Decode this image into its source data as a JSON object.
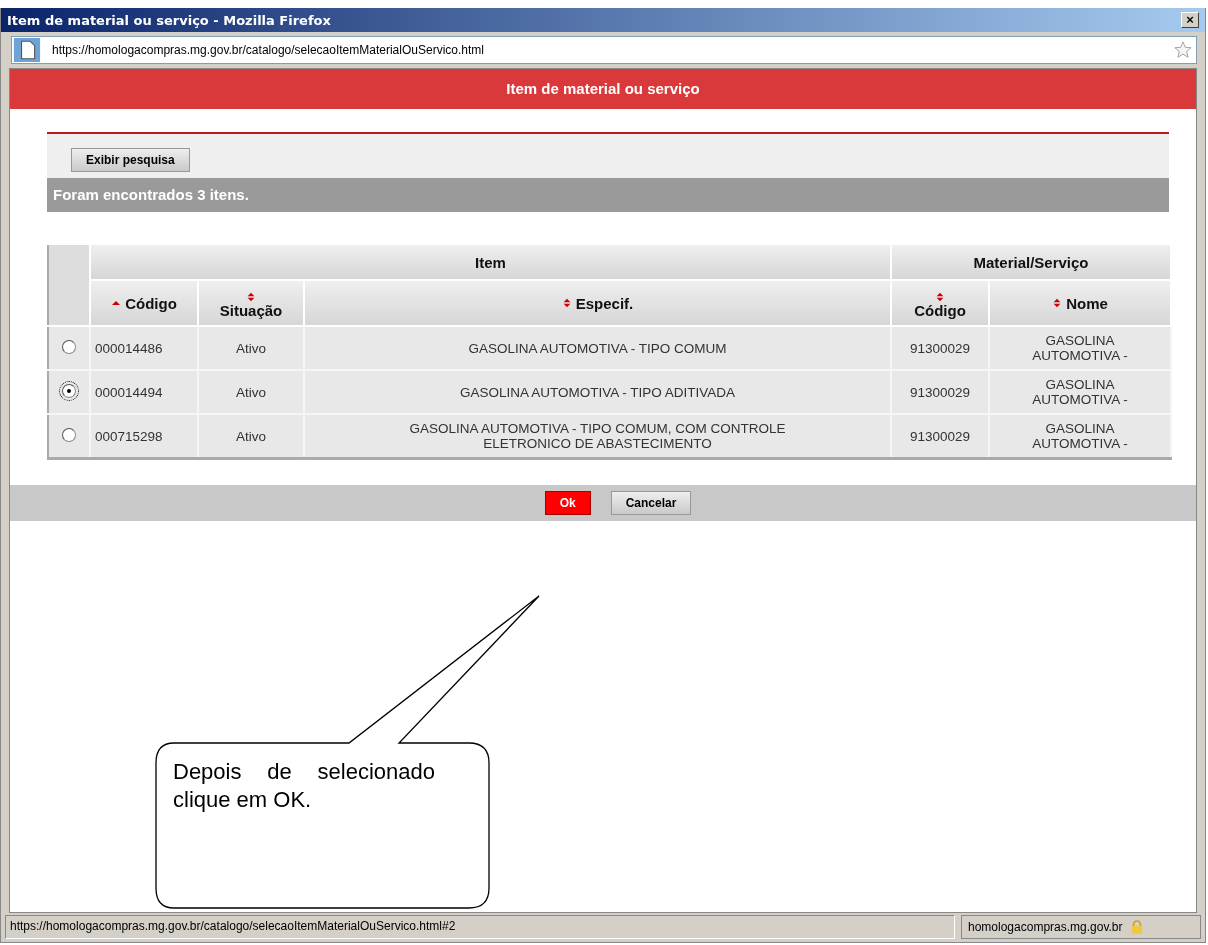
{
  "window": {
    "title": "Item de material ou serviço - Mozilla Firefox",
    "close": "×"
  },
  "address_bar": {
    "url": "https://homologacompras.mg.gov.br/catalogo/selecaoItemMaterialOuServico.html"
  },
  "page_header": "Item de material ou serviço",
  "search_button": "Exibir pesquisa",
  "results_banner": "Foram encontrados 3 itens.",
  "table": {
    "groups": [
      {
        "label": "Item",
        "columns": [
          {
            "label": "Código",
            "sorted": true
          },
          {
            "label": "Situação",
            "sorted": false
          },
          {
            "label": "Especif.",
            "sorted": false
          }
        ]
      },
      {
        "label": "Material/Serviço",
        "columns": [
          {
            "label": "Código",
            "sorted": false
          },
          {
            "label": "Nome",
            "sorted": false
          }
        ]
      }
    ],
    "rows": [
      {
        "selected": false,
        "cells": [
          "000014486",
          "Ativo",
          "GASOLINA AUTOMOTIVA - TIPO COMUM",
          "91300029",
          "GASOLINA AUTOMOTIVA -"
        ]
      },
      {
        "selected": true,
        "cells": [
          "000014494",
          "Ativo",
          "GASOLINA AUTOMOTIVA - TIPO ADITIVADA",
          "91300029",
          "GASOLINA AUTOMOTIVA -"
        ]
      },
      {
        "selected": false,
        "cells": [
          "000715298",
          "Ativo",
          "GASOLINA AUTOMOTIVA - TIPO COMUM, COM CONTROLE ELETRONICO DE ABASTECIMENTO",
          "91300029",
          "GASOLINA AUTOMOTIVA -"
        ]
      }
    ]
  },
  "buttons": [
    {
      "label": "Ok",
      "kind": "primary"
    },
    {
      "label": "Cancelar",
      "kind": "secondary"
    }
  ],
  "callout": "Depois de selecionado clique em OK.",
  "status_bar": {
    "url": "https://homologacompras.mg.gov.br/catalogo/selecaoItemMaterialOuServico.html#2",
    "domain": "homologacompras.mg.gov.br"
  }
}
